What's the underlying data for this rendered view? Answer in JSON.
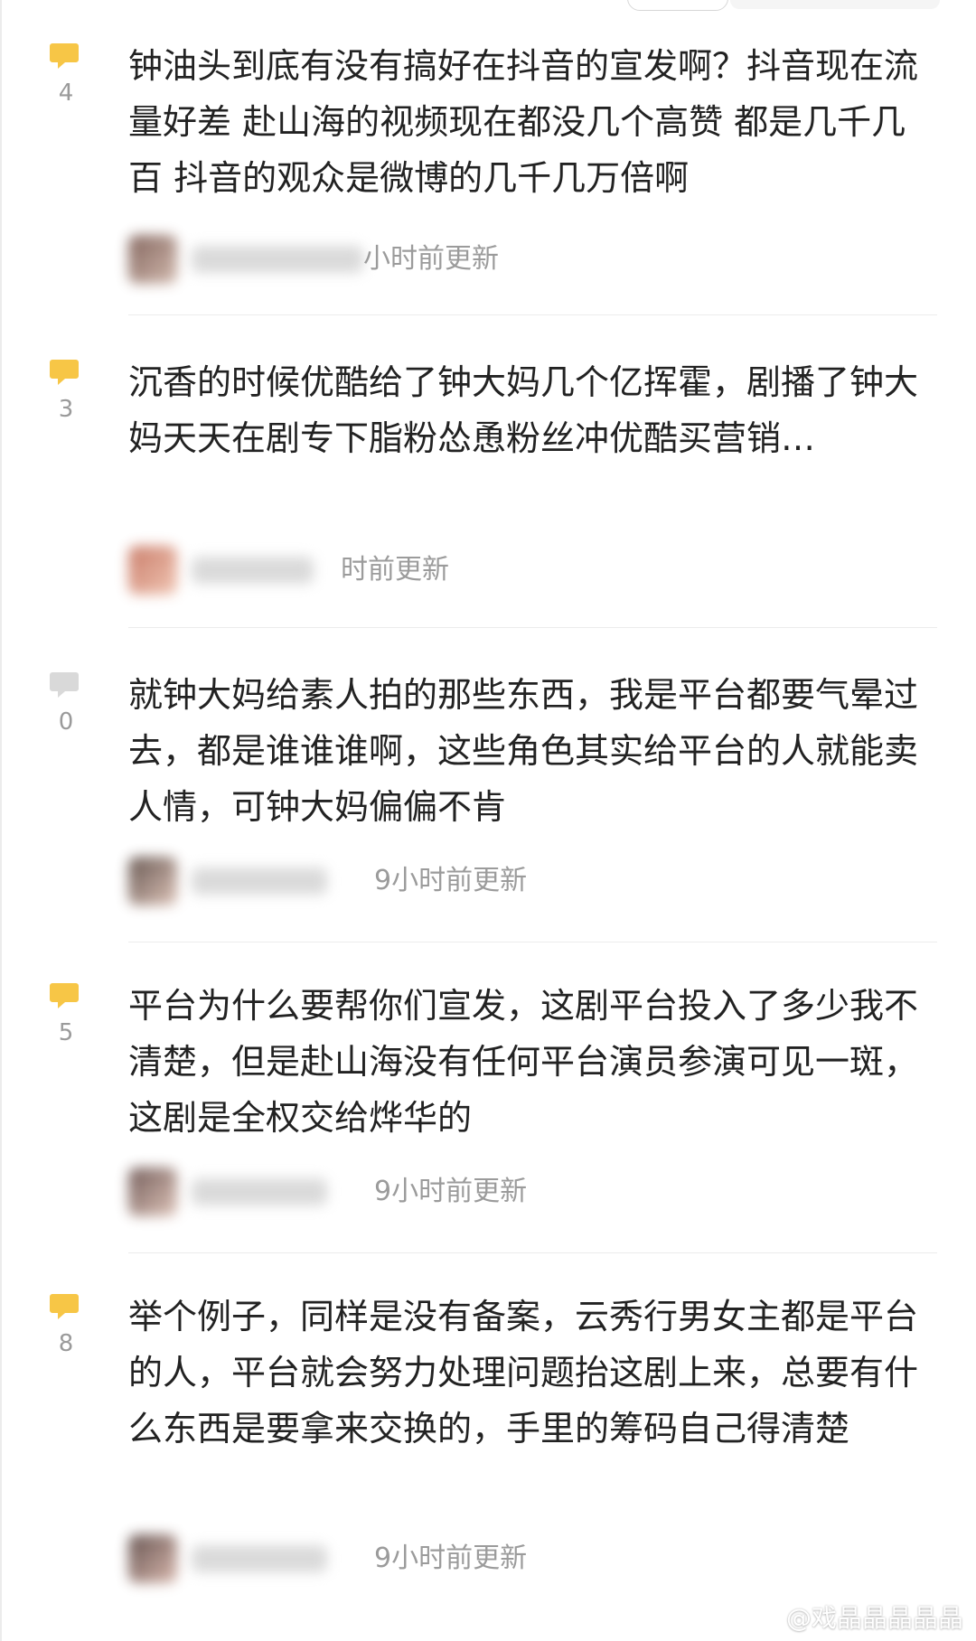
{
  "comments": [
    {
      "votes": "4",
      "text": "钟油头到底有没有搞好在抖音的宣发啊？抖音现在流量好差 赴山海的视频现在都没几个高赞 都是几千几百 抖音的观众是微博的几千几万倍啊",
      "time": "小时前更新"
    },
    {
      "votes": "3",
      "text": "沉香的时候优酷给了钟大妈几个亿挥霍，剧播了钟大妈天天在剧专下脂粉怂恿粉丝冲优酷买营销…",
      "time": "时前更新"
    },
    {
      "votes": "0",
      "text": "就钟大妈给素人拍的那些东西，我是平台都要气晕过去，都是谁谁谁啊，这些角色其实给平台的人就能卖人情，可钟大妈偏偏不肯",
      "time": "9小时前更新"
    },
    {
      "votes": "5",
      "text": "平台为什么要帮你们宣发，这剧平台投入了多少我不清楚，但是赴山海没有任何平台演员参演可见一斑，这剧是全权交给烨华的",
      "time": "9小时前更新"
    },
    {
      "votes": "8",
      "text": "举个例子，同样是没有备案，云秀行男女主都是平台的人，平台就会努力处理问题抬这剧上来，总要有什么东西是要拿来交换的，手里的筹码自己得清楚",
      "time": "9小时前更新"
    }
  ],
  "watermark": {
    "text": "@戏晶晶晶晶晶"
  },
  "colors": {
    "text": "#222222",
    "meta": "#9b9b9b",
    "vote_bubble_active": "#f7c646",
    "vote_bubble_inactive": "#d9d9d9",
    "divider": "#ececec"
  },
  "icons": {
    "vote": "speech-bubble-icon",
    "watermark": "weibo-icon"
  }
}
